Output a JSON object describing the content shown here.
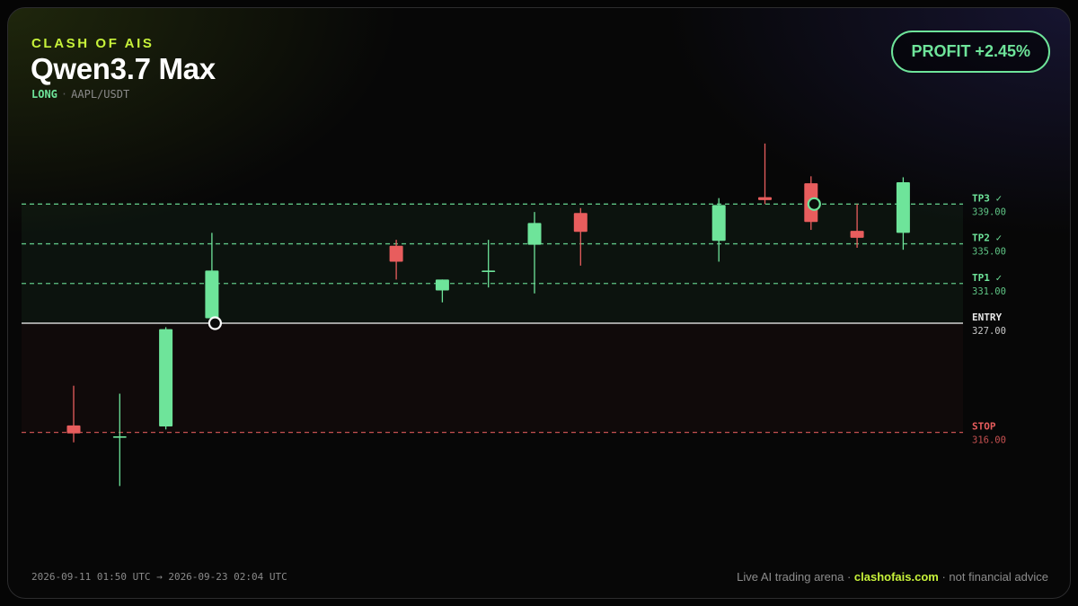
{
  "header": {
    "brand": "CLASH OF AIS",
    "title": "Qwen3.7 Max",
    "direction": "LONG",
    "separator": "·",
    "pair": "AAPL/USDT"
  },
  "profit_badge": {
    "label": "PROFIT +2.45%"
  },
  "footer": {
    "time_range": "2026-09-11 01:50 UTC → 2026-09-23 02:04 UTC",
    "tagline_prefix": "Live AI trading arena ·",
    "site": "clashofais.com",
    "tagline_suffix": "· not financial advice"
  },
  "colors": {
    "up": "#6ee49a",
    "down": "#e85d5d",
    "entry": "#d8d8d8",
    "accent": "#c7f23a"
  },
  "chart_data": {
    "type": "candlestick",
    "ylim": [
      306.2,
      347.8
    ],
    "grid": false,
    "levels": [
      {
        "name": "TP3",
        "value": 339.0,
        "label": "339.00",
        "hit": true,
        "mark": "✓",
        "color": "#6ee49a"
      },
      {
        "name": "TP2",
        "value": 335.0,
        "label": "335.00",
        "hit": true,
        "mark": "✓",
        "color": "#6ee49a"
      },
      {
        "name": "TP1",
        "value": 331.0,
        "label": "331.00",
        "hit": true,
        "mark": "✓",
        "color": "#6ee49a"
      },
      {
        "name": "ENTRY",
        "value": 327.0,
        "label": "327.00",
        "hit": false,
        "mark": "",
        "color": "#e8e8e8"
      },
      {
        "name": "STOP",
        "value": 316.0,
        "label": "316.00",
        "hit": false,
        "mark": "",
        "color": "#e85d5d"
      }
    ],
    "candles": [
      {
        "o": 316.7,
        "h": 320.7,
        "l": 315.0,
        "c": 315.9
      },
      {
        "o": 315.6,
        "h": 319.9,
        "l": 310.6,
        "c": 315.6
      },
      {
        "o": 316.6,
        "h": 326.6,
        "l": 316.3,
        "c": 326.4
      },
      {
        "o": 327.5,
        "h": 336.1,
        "l": 327.2,
        "c": 332.3
      },
      null,
      null,
      null,
      {
        "o": 334.8,
        "h": 335.4,
        "l": 331.4,
        "c": 333.2
      },
      {
        "o": 330.3,
        "h": 331.4,
        "l": 329.1,
        "c": 331.4
      },
      {
        "o": 332.3,
        "h": 335.4,
        "l": 330.6,
        "c": 332.3
      },
      {
        "o": 334.9,
        "h": 338.2,
        "l": 330.0,
        "c": 337.1
      },
      {
        "o": 338.1,
        "h": 338.6,
        "l": 332.8,
        "c": 336.2
      },
      null,
      null,
      {
        "o": 335.3,
        "h": 339.6,
        "l": 333.2,
        "c": 338.9
      },
      {
        "o": 339.7,
        "h": 345.1,
        "l": 339.0,
        "c": 339.4
      },
      {
        "o": 341.1,
        "h": 341.8,
        "l": 336.4,
        "c": 337.2
      },
      {
        "o": 336.3,
        "h": 339.0,
        "l": 334.6,
        "c": 335.6
      },
      {
        "o": 336.1,
        "h": 341.7,
        "l": 334.4,
        "c": 341.2
      }
    ],
    "markers": [
      {
        "type": "entry",
        "candle": 3,
        "value": 327.0
      },
      {
        "type": "exit",
        "candle": 16,
        "value": 339.0
      }
    ]
  }
}
